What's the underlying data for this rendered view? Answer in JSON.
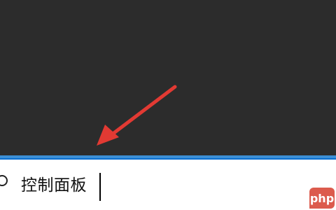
{
  "search": {
    "value": "控制面板"
  },
  "watermark": {
    "text": "php"
  },
  "colors": {
    "background": "#2c2c2c",
    "accent": "#0a6fd1",
    "arrow": "#e23a33",
    "search_bg": "#ffffff"
  },
  "icons": {
    "search": "search-icon",
    "annotation": "red-arrow-annotation"
  }
}
